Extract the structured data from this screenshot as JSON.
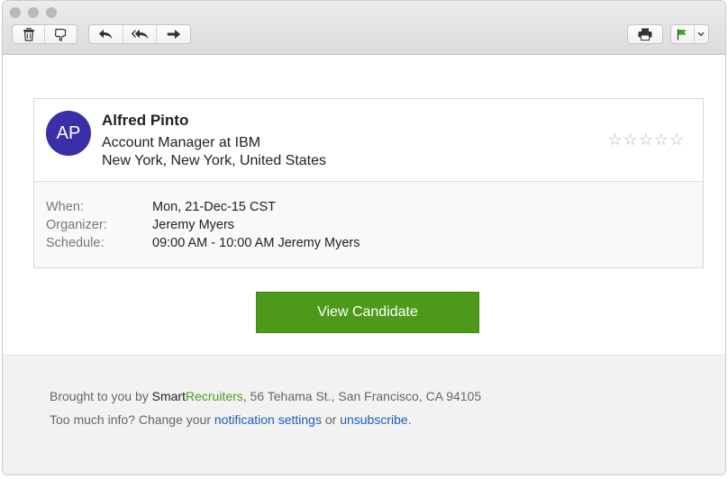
{
  "toolbar": {
    "delete_icon": "trash-icon",
    "junk_icon": "thumbs-down-icon",
    "reply_icon": "reply-arrow-icon",
    "reply_all_icon": "reply-all-icon",
    "forward_icon": "forward-arrow-icon",
    "print_icon": "printer-icon",
    "flag_icon": "flag-icon",
    "flag_color": "#3aa820"
  },
  "candidate": {
    "initials": "AP",
    "name": "Alfred Pinto",
    "title": "Account Manager at IBM",
    "location": "New York, New York, United States",
    "rating_stars": "☆☆☆☆☆",
    "rating": 0,
    "rating_max": 5,
    "avatar_color": "#3a2fa6"
  },
  "details": [
    {
      "label": "When:",
      "value": "Mon, 21-Dec-15 CST"
    },
    {
      "label": "Organizer:",
      "value": "Jeremy Myers"
    },
    {
      "label": "Schedule:",
      "value": "09:00 AM - 10:00 AM Jeremy Myers"
    }
  ],
  "cta": {
    "label": "View Candidate",
    "color": "#4d9a1b"
  },
  "footer": {
    "brought_prefix": "Brought to you by ",
    "brand_part1": "Smart",
    "brand_part2": "Recruiters",
    "address": ", 56 Tehama St., San Francisco, CA 94105",
    "info_prefix": "Too much info? Change your ",
    "settings_link": "notification settings",
    "or_text": " or ",
    "unsubscribe_link": "unsubscribe",
    "period": "."
  }
}
